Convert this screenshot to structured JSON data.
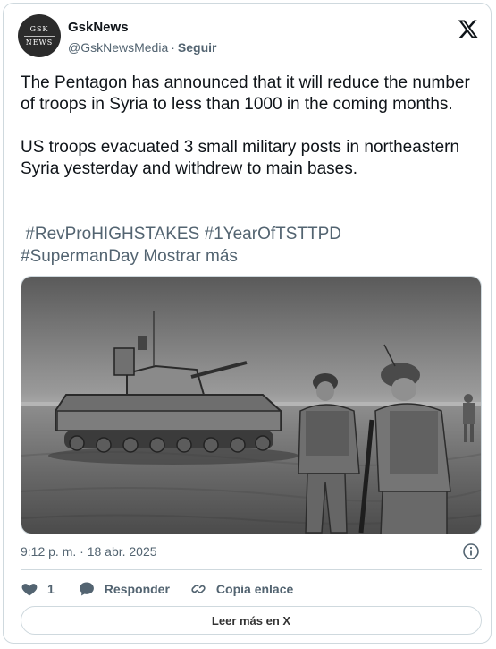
{
  "author": {
    "name": "GskNews",
    "handle": "@GskNewsMedia",
    "separator": "·",
    "follow_label": "Seguir",
    "avatar_line1": "GSK",
    "avatar_line2": "NEWS"
  },
  "icons": {
    "platform": "x-logo-icon",
    "info": "info-icon",
    "like": "heart-icon",
    "reply": "speech-bubble-icon",
    "copy": "link-icon"
  },
  "tweet": {
    "text": "The Pentagon has announced that it will reduce the number of troops in Syria to less than 1000 in the coming months.\n\nUS troops evacuated 3 small military posts in northeastern Syria yesterday and withdrew to main bases.",
    "hashtags_line1": " #RevProHIGHSTAKES #1YearOfTSTTPD",
    "hashtags_line2": "#SupermanDay",
    "show_more": "Mostrar más",
    "timestamp": "9:12 p. m. · 18 abr. 2025"
  },
  "actions": {
    "like_count": "1",
    "reply_label": "Responder",
    "copy_label": "Copia enlace",
    "read_more_label": "Leer más en X"
  },
  "colors": {
    "text": "#0f1419",
    "secondary": "#536471",
    "border": "#cfd9de",
    "like_heart": "#536471"
  }
}
